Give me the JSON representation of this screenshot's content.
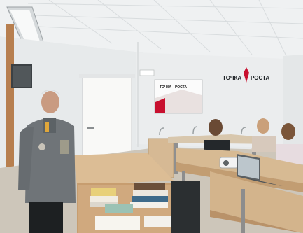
{
  "scene": {
    "logo": {
      "text_left": "ТОЧКА",
      "text_right": "РОСТА",
      "accent": "#c8102e"
    },
    "poster": {
      "text_left": "ТОЧКА",
      "text_right": "РОСТА"
    },
    "colors": {
      "wall": "#eceff0",
      "ceiling": "#f1f3f4",
      "uniform": "#6f7478",
      "desk_wood": "#c9a57e",
      "desk_top": "#d9bb94",
      "floor": "#cfc8bd",
      "door": "#f7f7f5",
      "laptop": "#5e6468",
      "red_brand": "#c8102e"
    }
  }
}
